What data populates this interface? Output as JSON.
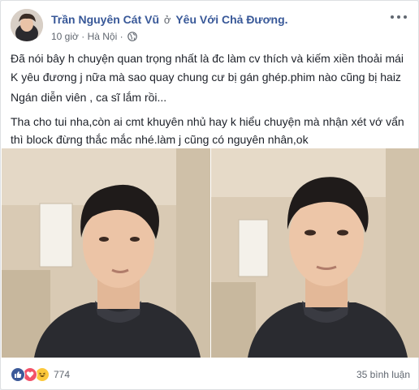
{
  "post": {
    "author": "Trần Nguyên Cát Vũ",
    "group_arrow": "ở",
    "group": "Yêu Với Chả Đương.",
    "time": "10 giờ",
    "separator": "·",
    "location": "Hà Nội",
    "privacy_icon": "globe-icon",
    "more_icon": "more-options-icon",
    "paragraphs": [
      "Đã nói bây h chuyện quan trọng nhất là đc làm cv thích và kiếm xiền thoải mái",
      "K yêu đương j nữa mà sao quay chung cư bị gán ghép.phim nào cũng bị haiz",
      "Ngán diễn viên , ca sĩ lắm rồi...",
      "Tha cho tui nha,còn ai cmt khuyên nhủ hay k hiểu chuyện mà nhận xét vớ vẩn thì block đừng thắc mắc nhé.làm j cũng có nguyên nhân,ok"
    ]
  },
  "photos": [
    {
      "name": "selfie-photo-left"
    },
    {
      "name": "selfie-photo-right"
    }
  ],
  "footer": {
    "reaction_icons": [
      "like-icon",
      "love-icon",
      "haha-icon"
    ],
    "reaction_count": "774",
    "comment_count": "35 bình luận"
  },
  "colors": {
    "link": "#385898",
    "meta": "#616770",
    "like": "#3b5998",
    "love": "#f25268",
    "haha": "#fcc83b"
  }
}
